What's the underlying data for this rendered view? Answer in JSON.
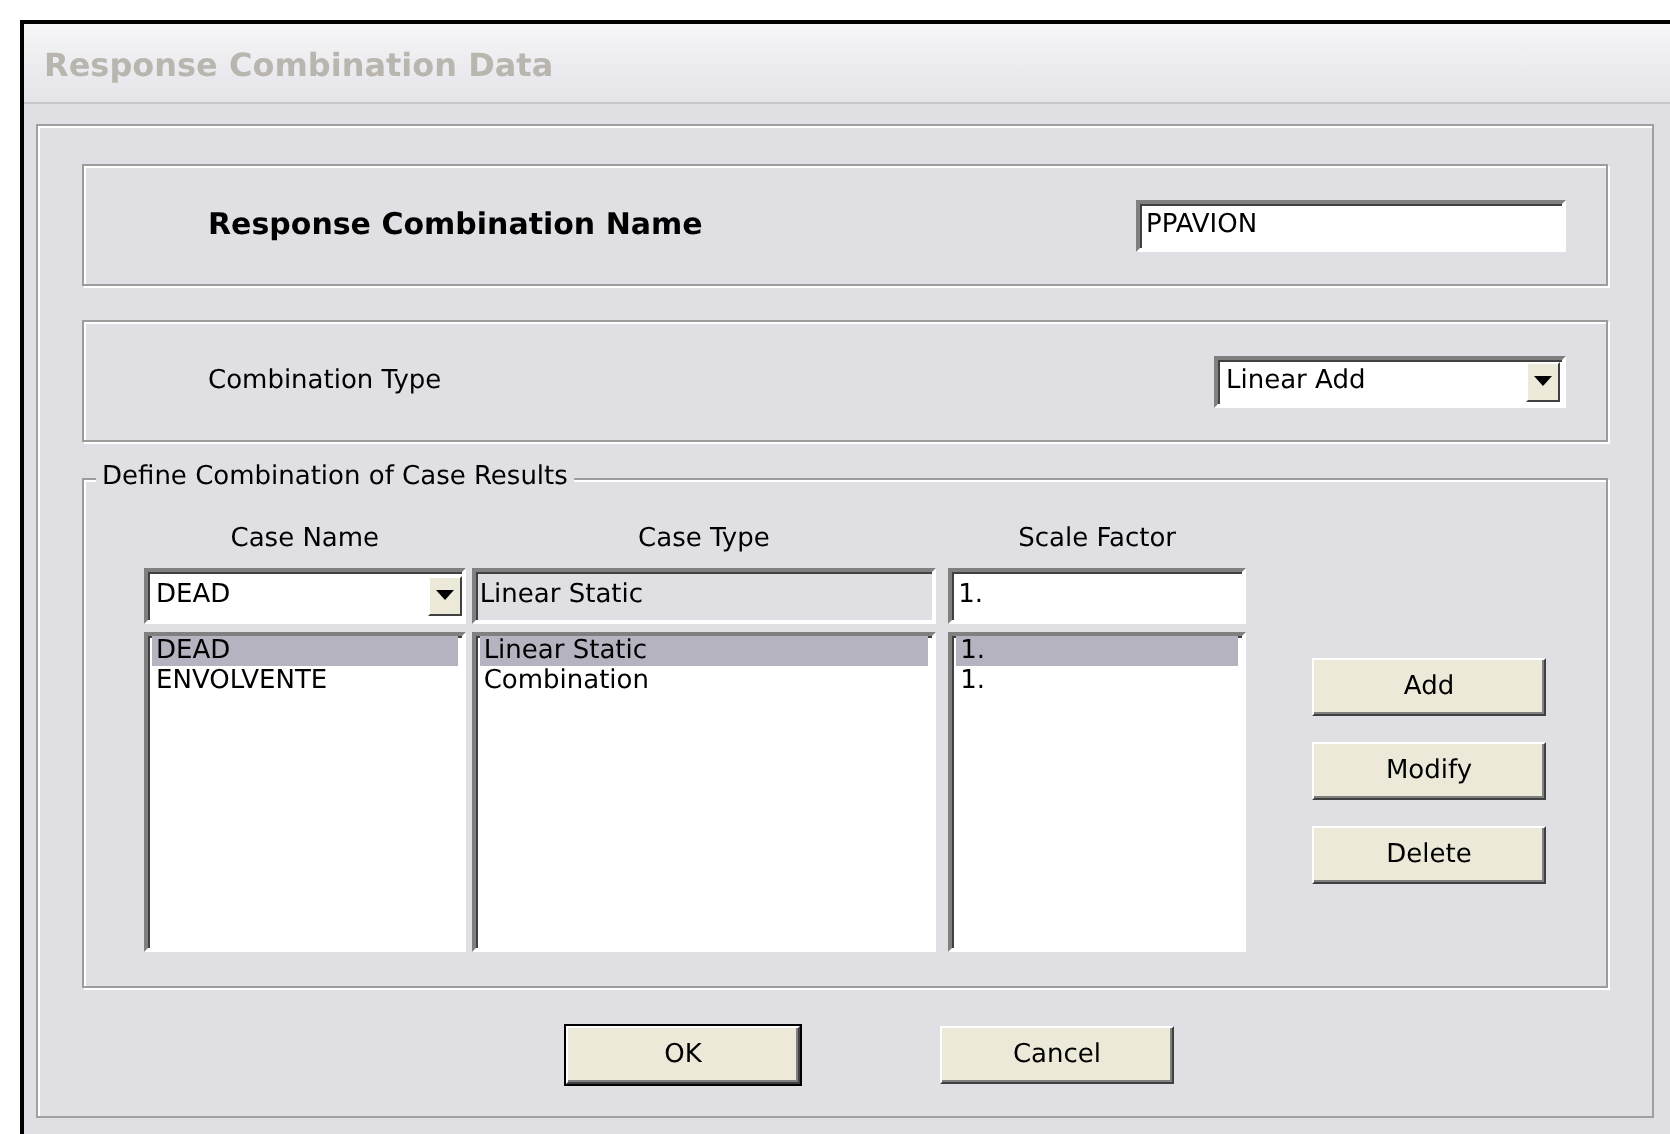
{
  "window": {
    "title": "Response Combination Data"
  },
  "name_field": {
    "label": "Response Combination Name",
    "value": "PPAVION"
  },
  "combination_type": {
    "label": "Combination Type",
    "value": "Linear Add"
  },
  "group": {
    "title": "Define Combination of Case Results",
    "columns": [
      "Case Name",
      "Case Type",
      "Scale Factor"
    ],
    "entry": {
      "case_name": "DEAD",
      "case_type": "Linear Static",
      "scale_factor": "1."
    },
    "rows": [
      {
        "case_name": "DEAD",
        "case_type": "Linear Static",
        "scale_factor": "1.",
        "selected": true
      },
      {
        "case_name": "ENVOLVENTE",
        "case_type": "Combination",
        "scale_factor": "1.",
        "selected": false
      }
    ],
    "side_buttons": [
      "Add",
      "Modify",
      "Delete"
    ]
  },
  "buttons": [
    {
      "label": "OK",
      "default": true
    },
    {
      "label": "Cancel",
      "default": false
    }
  ]
}
